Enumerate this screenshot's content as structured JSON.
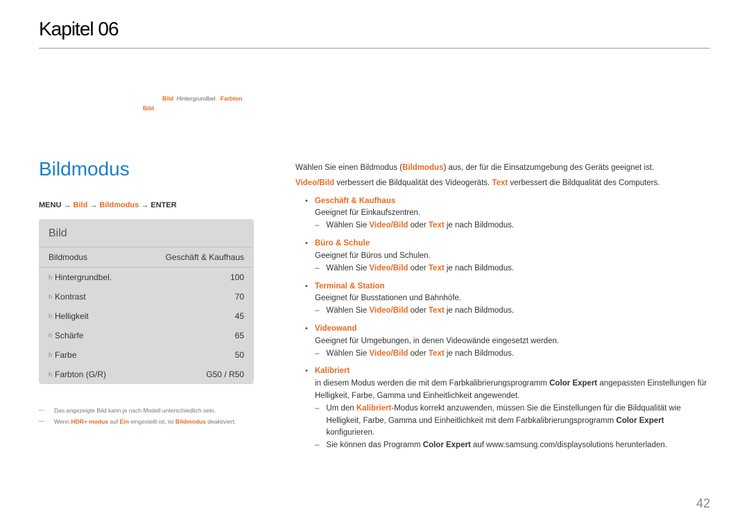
{
  "chapter": "Kapitel 06",
  "note_top": {
    "row1_pre": "",
    "row1_hl1": "Bild",
    "row1_mid": "Hintergrundbel.",
    "row1_hl2": "Farbton",
    "row2_hl": "Bild"
  },
  "title": "Bildmodus",
  "breadcrumb": {
    "menu": "MENU",
    "arrow": "→",
    "bild": "Bild",
    "bildmodus": "Bildmodus",
    "enter": "ENTER"
  },
  "panel": {
    "header": "Bild",
    "rows": [
      {
        "label": "Bildmodus",
        "value": "Geschäft & Kaufhaus",
        "prefix": ""
      },
      {
        "label": "Hintergrundbel.",
        "value": "100",
        "prefix": "h"
      },
      {
        "label": "Kontrast",
        "value": "70",
        "prefix": "h"
      },
      {
        "label": "Helligkeit",
        "value": "45",
        "prefix": "h"
      },
      {
        "label": "Schärfe",
        "value": "65",
        "prefix": "h"
      },
      {
        "label": "Farbe",
        "value": "50",
        "prefix": "h"
      },
      {
        "label": "Farbton (G/R)",
        "value": "G50 / R50",
        "prefix": "h"
      }
    ]
  },
  "footnotes": {
    "f1": "Das angezeigte Bild kann je nach Modell unterschiedlich sein.",
    "f2_pre": "Wenn ",
    "f2_hl1": "HDR+ modus",
    "f2_mid1": " auf ",
    "f2_hl2": "Ein",
    "f2_mid2": " eingestellt ist, ist ",
    "f2_hl3": "Bildmodus",
    "f2_post": " deaktiviert."
  },
  "right": {
    "p1_pre": "Wählen Sie einen Bildmodus (",
    "p1_hl": "Bildmodus",
    "p1_post": ") aus, der für die Einsatzumgebung des Geräts geeignet ist.",
    "p2_hl1": "Video/Bild",
    "p2_mid": " verbessert die Bildqualität des Videogeräts. ",
    "p2_hl2": "Text",
    "p2_post": " verbessert die Bildqualität des Computers.",
    "modes": [
      {
        "title": "Geschäft & Kaufhaus",
        "desc": "Geeignet für Einkaufszentren.",
        "sub_pre": "Wählen Sie ",
        "sub_hl1": "Video/Bild",
        "sub_mid": " oder ",
        "sub_hl2": "Text",
        "sub_post": " je nach Bildmodus."
      },
      {
        "title": "Büro & Schule",
        "desc": "Geeignet für Büros und Schulen.",
        "sub_pre": "Wählen Sie ",
        "sub_hl1": "Video/Bild",
        "sub_mid": " oder ",
        "sub_hl2": "Text",
        "sub_post": " je nach Bildmodus."
      },
      {
        "title": "Terminal & Station",
        "desc": "Geeignet für Busstationen und Bahnhöfe.",
        "sub_pre": "Wählen Sie ",
        "sub_hl1": "Video/Bild",
        "sub_mid": " oder ",
        "sub_hl2": "Text",
        "sub_post": " je nach Bildmodus."
      },
      {
        "title": "Videowand",
        "desc": "Geeignet für Umgebungen, in denen Videowände eingesetzt werden.",
        "sub_pre": "Wählen Sie ",
        "sub_hl1": "Video/Bild",
        "sub_mid": " oder ",
        "sub_hl2": "Text",
        "sub_post": " je nach Bildmodus."
      }
    ],
    "kalibriert": {
      "title": "Kalibriert",
      "desc_pre": "in diesem Modus werden die mit dem Farbkalibrierungsprogramm ",
      "desc_bold": "Color Expert",
      "desc_post": " angepassten Einstellungen für Helligkeit, Farbe, Gamma und Einheitlichkeit angewendet.",
      "s1_pre": "Um den ",
      "s1_hl": "Kalibriert",
      "s1_mid": "-Modus korrekt anzuwenden, müssen Sie die Einstellungen für die Bildqualität wie Helligkeit, Farbe, Gamma und Einheitlichkeit mit dem Farbkalibrierungsprogramm ",
      "s1_bold": "Color Expert",
      "s1_post": " konfigurieren.",
      "s2_pre": "Sie können das Programm ",
      "s2_bold": "Color Expert",
      "s2_post": " auf www.samsung.com/displaysolutions herunterladen."
    }
  },
  "page_number": "42"
}
